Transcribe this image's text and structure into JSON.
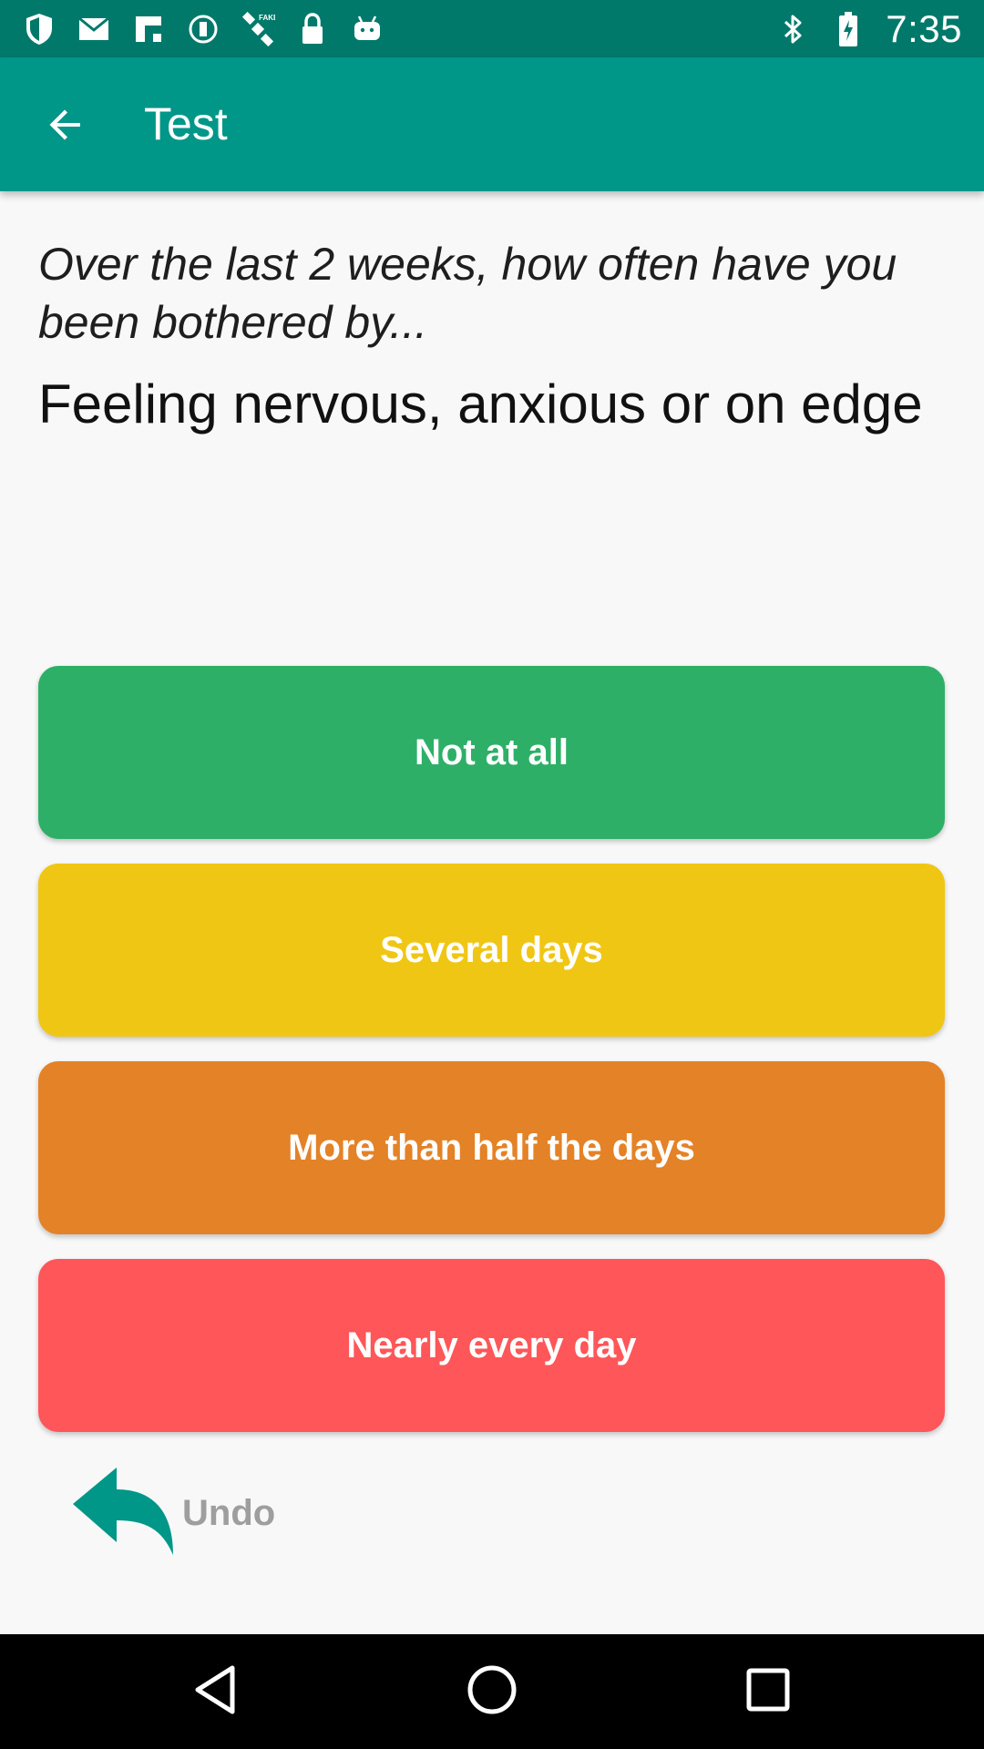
{
  "status_bar": {
    "time": "7:35",
    "left_icons": [
      "shield-icon",
      "mail-icon",
      "flipboard-icon",
      "circle-icon",
      "satellite-fake-gps-icon",
      "lock-icon",
      "android-icon"
    ],
    "right_icons": [
      "bluetooth-icon",
      "battery-icon"
    ]
  },
  "app_bar": {
    "title": "Test",
    "back_icon": "arrow-left-icon",
    "color": "#009688"
  },
  "content": {
    "prompt": "Over the last 2 weeks, how often have you been bothered by...",
    "question": "Feeling nervous, anxious or on edge"
  },
  "answers": [
    {
      "label": "Not at all",
      "color": "#2eaf67"
    },
    {
      "label": "Several days",
      "color": "#f0c614"
    },
    {
      "label": "More than half the days",
      "color": "#e48227"
    },
    {
      "label": "Nearly every day",
      "color": "#ff5659"
    }
  ],
  "undo": {
    "label": "Undo",
    "icon": "reply-arrow-icon",
    "icon_color": "#009688"
  },
  "nav_bar": {
    "icons": [
      "back-triangle-icon",
      "home-circle-icon",
      "recents-square-icon"
    ]
  }
}
